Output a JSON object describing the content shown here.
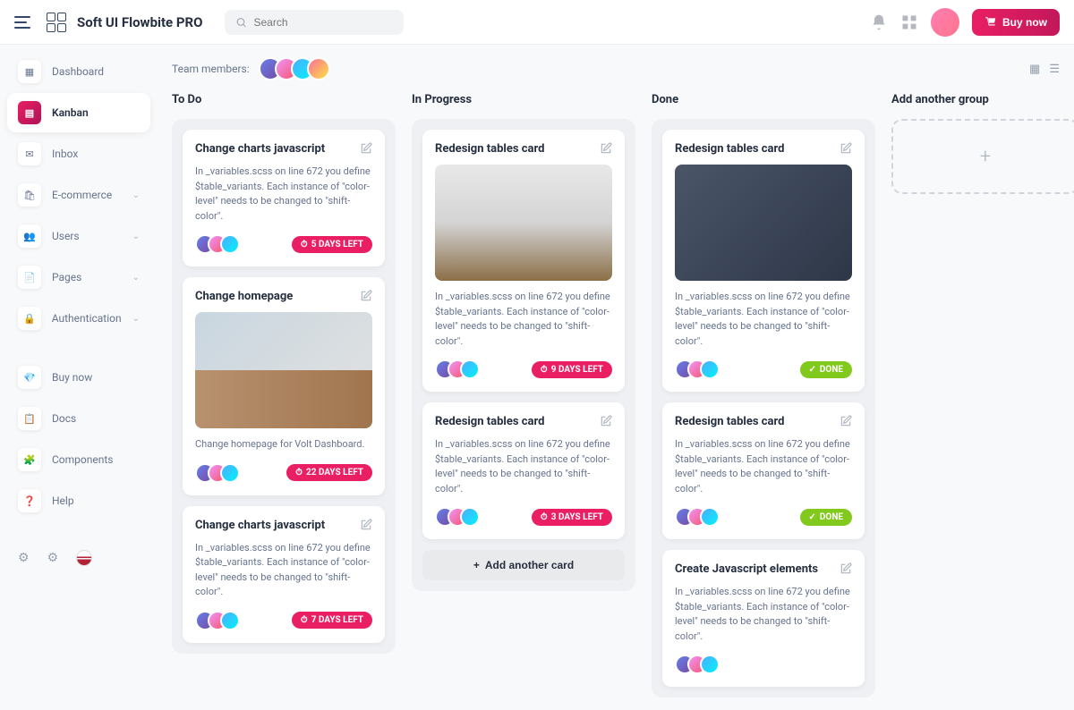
{
  "header": {
    "brand": "Soft UI Flowbite PRO",
    "search_placeholder": "Search",
    "buy_label": "Buy now"
  },
  "sidebar": {
    "items": [
      {
        "label": "Dashboard",
        "expandable": false
      },
      {
        "label": "Kanban",
        "expandable": false
      },
      {
        "label": "Inbox",
        "expandable": false
      },
      {
        "label": "E-commerce",
        "expandable": true
      },
      {
        "label": "Users",
        "expandable": true
      },
      {
        "label": "Pages",
        "expandable": true
      },
      {
        "label": "Authentication",
        "expandable": true
      }
    ],
    "secondary": [
      {
        "label": "Buy now"
      },
      {
        "label": "Docs"
      },
      {
        "label": "Components"
      },
      {
        "label": "Help"
      }
    ]
  },
  "team_label": "Team members:",
  "columns": [
    {
      "title": "To Do",
      "cards": [
        {
          "title": "Change charts javascript",
          "desc": "In _variables.scss on line 672 you define $table_variants. Each instance of \"color-level\" needs to be changed to \"shift-color\".",
          "badge": "5 DAYS LEFT",
          "badge_type": "pink"
        },
        {
          "title": "Change homepage",
          "desc": "Change homepage for Volt Dashboard.",
          "badge": "22 DAYS LEFT",
          "badge_type": "pink",
          "image": "img1"
        },
        {
          "title": "Change charts javascript",
          "desc": "In _variables.scss on line 672 you define $table_variants. Each instance of \"color-level\" needs to be changed to \"shift-color\".",
          "badge": "7 DAYS LEFT",
          "badge_type": "pink"
        }
      ]
    },
    {
      "title": "In Progress",
      "cards": [
        {
          "title": "Redesign tables card",
          "desc": "In _variables.scss on line 672 you define $table_variants. Each instance of \"color-level\" needs to be changed to \"shift-color\".",
          "badge": "9 DAYS LEFT",
          "badge_type": "pink",
          "image": "img2"
        },
        {
          "title": "Redesign tables card",
          "desc": "In _variables.scss on line 672 you define $table_variants. Each instance of \"color-level\" needs to be changed to \"shift-color\".",
          "badge": "3 DAYS LEFT",
          "badge_type": "pink"
        }
      ],
      "add_card": "Add another card"
    },
    {
      "title": "Done",
      "cards": [
        {
          "title": "Redesign tables card",
          "desc": "In _variables.scss on line 672 you define $table_variants. Each instance of \"color-level\" needs to be changed to \"shift-color\".",
          "badge": "DONE",
          "badge_type": "green",
          "image": "img3"
        },
        {
          "title": "Redesign tables card",
          "desc": "In _variables.scss on line 672 you define $table_variants. Each instance of \"color-level\" needs to be changed to \"shift-color\".",
          "badge": "DONE",
          "badge_type": "green"
        },
        {
          "title": "Create Javascript elements",
          "desc": "In _variables.scss on line 672 you define $table_variants. Each instance of \"color-level\" needs to be changed to \"shift-color\"."
        }
      ]
    }
  ],
  "add_group_label": "Add another group"
}
